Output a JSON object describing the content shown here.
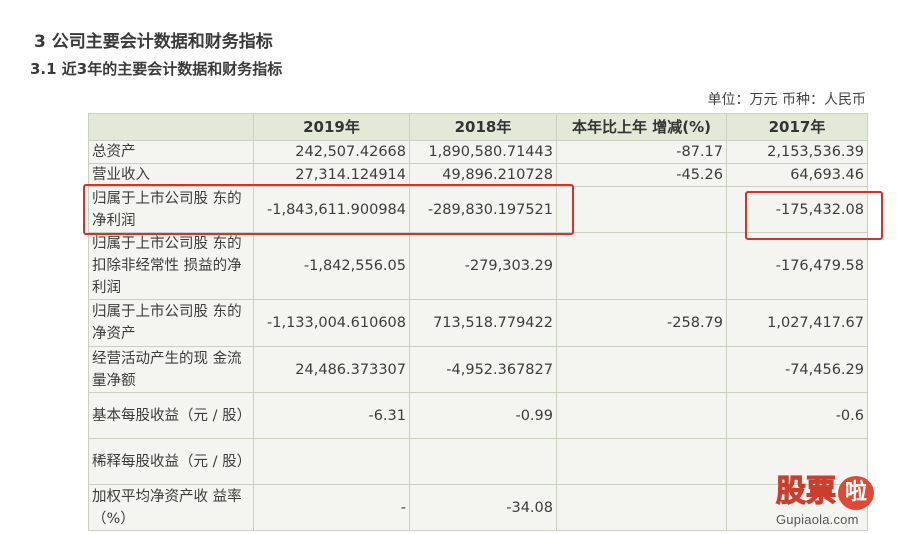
{
  "section_title": "3 公司主要会计数据和财务指标",
  "subsection_title": "3.1 近3年的主要会计数据和财务指标",
  "unit_note": "单位：万元 币种：人民币",
  "table": {
    "headers": [
      "",
      "2019年",
      "2018年",
      "本年比上年 增减(%)",
      "2017年"
    ],
    "rows": [
      [
        "总资产",
        "242,507.42668",
        "1,890,580.71443",
        "-87.17",
        "2,153,536.39"
      ],
      [
        "营业收入",
        "27,314.124914",
        "49,896.210728",
        "-45.26",
        "64,693.46"
      ],
      [
        "归属于上市公司股 东的净利润",
        "-1,843,611.900984",
        "-289,830.197521",
        "",
        "-175,432.08"
      ],
      [
        "归属于上市公司股 东的扣除非经常性 损益的净利润",
        "-1,842,556.05",
        "-279,303.29",
        "",
        "-176,479.58"
      ],
      [
        "归属于上市公司股 东的净资产",
        "-1,133,004.610608",
        "713,518.779422",
        "-258.79",
        "1,027,417.67"
      ],
      [
        "经营活动产生的现 金流量净额",
        "24,486.373307",
        "-4,952.367827",
        "",
        "-74,456.29"
      ],
      [
        "基本每股收益（元 / 股）",
        "-6.31",
        "-0.99",
        "",
        "-0.6"
      ],
      [
        "稀释每股收益（元 / 股）",
        "",
        "",
        "",
        ""
      ],
      [
        "加权平均净资产收 益率（%）",
        "-",
        "-34.08",
        "",
        ""
      ]
    ]
  },
  "watermark": {
    "brand_chars": [
      "股",
      "票"
    ],
    "brand_badge": "啦",
    "url": "Gupiaola.com"
  },
  "colors": {
    "header_bg": "#e2e9d6",
    "body_bg": "#f4f5f0",
    "border": "#c9cfc1",
    "highlight": "#d9302a"
  }
}
